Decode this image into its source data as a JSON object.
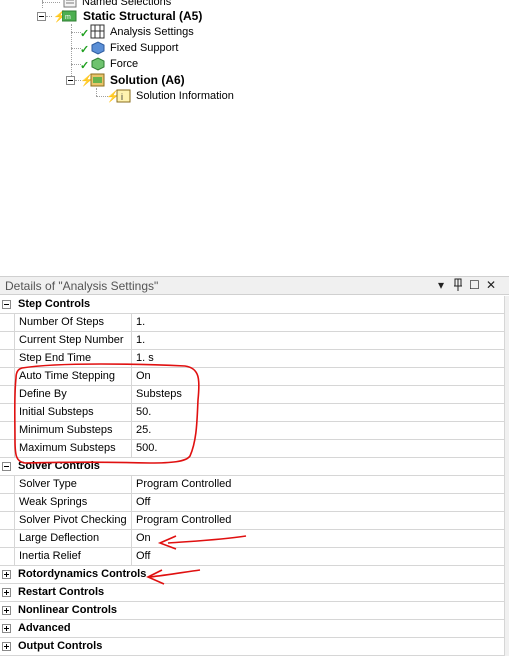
{
  "tree": {
    "named_selections": "Named Selections",
    "static_structural": "Static Structural (A5)",
    "analysis_settings": "Analysis Settings",
    "fixed_support": "Fixed Support",
    "force": "Force",
    "solution": "Solution (A6)",
    "solution_information": "Solution Information"
  },
  "details": {
    "title": "Details of \"Analysis Settings\"",
    "controls": {
      "dropdown": "▾",
      "pin": "📌",
      "maximize": "☐",
      "close": "✕"
    }
  },
  "sections": {
    "step_controls": "Step Controls",
    "solver_controls": "Solver Controls",
    "rotordynamics_controls": "Rotordynamics Controls",
    "restart_controls": "Restart Controls",
    "nonlinear_controls": "Nonlinear Controls",
    "advanced": "Advanced",
    "output_controls": "Output Controls"
  },
  "step_rows": [
    {
      "name": "Number Of Steps",
      "value": "1."
    },
    {
      "name": "Current Step Number",
      "value": "1."
    },
    {
      "name": "Step End Time",
      "value": "1. s"
    },
    {
      "name": "Auto Time Stepping",
      "value": "On"
    },
    {
      "name": "Define By",
      "value": "Substeps"
    },
    {
      "name": "Initial Substeps",
      "value": "50."
    },
    {
      "name": "Minimum Substeps",
      "value": "25."
    },
    {
      "name": "Maximum Substeps",
      "value": "500."
    }
  ],
  "solver_rows": [
    {
      "name": "Solver Type",
      "value": "Program Controlled"
    },
    {
      "name": "Weak Springs",
      "value": "Off"
    },
    {
      "name": "Solver Pivot Checking",
      "value": "Program Controlled"
    },
    {
      "name": "Large Deflection",
      "value": "On"
    },
    {
      "name": "Inertia Relief",
      "value": "Off"
    }
  ],
  "colors": {
    "annotation": "#e01010",
    "check": "#20a020",
    "bolt": "#d0b000"
  }
}
